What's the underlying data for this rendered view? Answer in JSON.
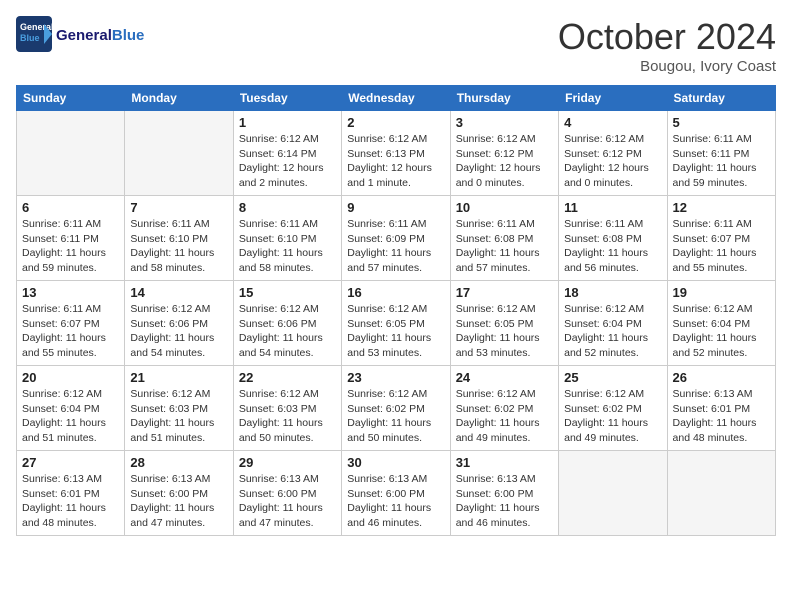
{
  "header": {
    "logo_general": "General",
    "logo_blue": "Blue",
    "month_title": "October 2024",
    "location": "Bougou, Ivory Coast"
  },
  "weekdays": [
    "Sunday",
    "Monday",
    "Tuesday",
    "Wednesday",
    "Thursday",
    "Friday",
    "Saturday"
  ],
  "weeks": [
    [
      {
        "day": "",
        "detail": ""
      },
      {
        "day": "",
        "detail": ""
      },
      {
        "day": "1",
        "detail": "Sunrise: 6:12 AM\nSunset: 6:14 PM\nDaylight: 12 hours\nand 2 minutes."
      },
      {
        "day": "2",
        "detail": "Sunrise: 6:12 AM\nSunset: 6:13 PM\nDaylight: 12 hours\nand 1 minute."
      },
      {
        "day": "3",
        "detail": "Sunrise: 6:12 AM\nSunset: 6:12 PM\nDaylight: 12 hours\nand 0 minutes."
      },
      {
        "day": "4",
        "detail": "Sunrise: 6:12 AM\nSunset: 6:12 PM\nDaylight: 12 hours\nand 0 minutes."
      },
      {
        "day": "5",
        "detail": "Sunrise: 6:11 AM\nSunset: 6:11 PM\nDaylight: 11 hours\nand 59 minutes."
      }
    ],
    [
      {
        "day": "6",
        "detail": "Sunrise: 6:11 AM\nSunset: 6:11 PM\nDaylight: 11 hours\nand 59 minutes."
      },
      {
        "day": "7",
        "detail": "Sunrise: 6:11 AM\nSunset: 6:10 PM\nDaylight: 11 hours\nand 58 minutes."
      },
      {
        "day": "8",
        "detail": "Sunrise: 6:11 AM\nSunset: 6:10 PM\nDaylight: 11 hours\nand 58 minutes."
      },
      {
        "day": "9",
        "detail": "Sunrise: 6:11 AM\nSunset: 6:09 PM\nDaylight: 11 hours\nand 57 minutes."
      },
      {
        "day": "10",
        "detail": "Sunrise: 6:11 AM\nSunset: 6:08 PM\nDaylight: 11 hours\nand 57 minutes."
      },
      {
        "day": "11",
        "detail": "Sunrise: 6:11 AM\nSunset: 6:08 PM\nDaylight: 11 hours\nand 56 minutes."
      },
      {
        "day": "12",
        "detail": "Sunrise: 6:11 AM\nSunset: 6:07 PM\nDaylight: 11 hours\nand 55 minutes."
      }
    ],
    [
      {
        "day": "13",
        "detail": "Sunrise: 6:11 AM\nSunset: 6:07 PM\nDaylight: 11 hours\nand 55 minutes."
      },
      {
        "day": "14",
        "detail": "Sunrise: 6:12 AM\nSunset: 6:06 PM\nDaylight: 11 hours\nand 54 minutes."
      },
      {
        "day": "15",
        "detail": "Sunrise: 6:12 AM\nSunset: 6:06 PM\nDaylight: 11 hours\nand 54 minutes."
      },
      {
        "day": "16",
        "detail": "Sunrise: 6:12 AM\nSunset: 6:05 PM\nDaylight: 11 hours\nand 53 minutes."
      },
      {
        "day": "17",
        "detail": "Sunrise: 6:12 AM\nSunset: 6:05 PM\nDaylight: 11 hours\nand 53 minutes."
      },
      {
        "day": "18",
        "detail": "Sunrise: 6:12 AM\nSunset: 6:04 PM\nDaylight: 11 hours\nand 52 minutes."
      },
      {
        "day": "19",
        "detail": "Sunrise: 6:12 AM\nSunset: 6:04 PM\nDaylight: 11 hours\nand 52 minutes."
      }
    ],
    [
      {
        "day": "20",
        "detail": "Sunrise: 6:12 AM\nSunset: 6:04 PM\nDaylight: 11 hours\nand 51 minutes."
      },
      {
        "day": "21",
        "detail": "Sunrise: 6:12 AM\nSunset: 6:03 PM\nDaylight: 11 hours\nand 51 minutes."
      },
      {
        "day": "22",
        "detail": "Sunrise: 6:12 AM\nSunset: 6:03 PM\nDaylight: 11 hours\nand 50 minutes."
      },
      {
        "day": "23",
        "detail": "Sunrise: 6:12 AM\nSunset: 6:02 PM\nDaylight: 11 hours\nand 50 minutes."
      },
      {
        "day": "24",
        "detail": "Sunrise: 6:12 AM\nSunset: 6:02 PM\nDaylight: 11 hours\nand 49 minutes."
      },
      {
        "day": "25",
        "detail": "Sunrise: 6:12 AM\nSunset: 6:02 PM\nDaylight: 11 hours\nand 49 minutes."
      },
      {
        "day": "26",
        "detail": "Sunrise: 6:13 AM\nSunset: 6:01 PM\nDaylight: 11 hours\nand 48 minutes."
      }
    ],
    [
      {
        "day": "27",
        "detail": "Sunrise: 6:13 AM\nSunset: 6:01 PM\nDaylight: 11 hours\nand 48 minutes."
      },
      {
        "day": "28",
        "detail": "Sunrise: 6:13 AM\nSunset: 6:00 PM\nDaylight: 11 hours\nand 47 minutes."
      },
      {
        "day": "29",
        "detail": "Sunrise: 6:13 AM\nSunset: 6:00 PM\nDaylight: 11 hours\nand 47 minutes."
      },
      {
        "day": "30",
        "detail": "Sunrise: 6:13 AM\nSunset: 6:00 PM\nDaylight: 11 hours\nand 46 minutes."
      },
      {
        "day": "31",
        "detail": "Sunrise: 6:13 AM\nSunset: 6:00 PM\nDaylight: 11 hours\nand 46 minutes."
      },
      {
        "day": "",
        "detail": ""
      },
      {
        "day": "",
        "detail": ""
      }
    ]
  ]
}
